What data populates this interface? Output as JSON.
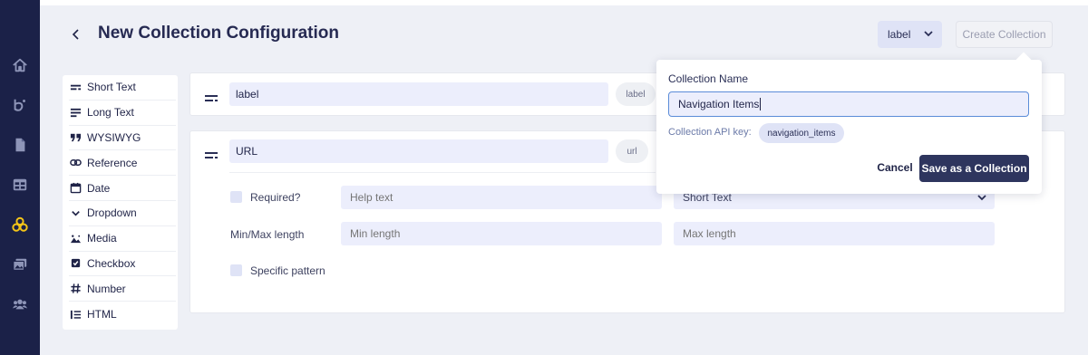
{
  "header": {
    "title": "New Collection Configuration",
    "back_icon": "chevron-left-icon",
    "label_select_value": "label",
    "create_button": "Create Collection"
  },
  "sidebar": {
    "items": [
      {
        "icon": "home-icon"
      },
      {
        "icon": "blog-icon"
      },
      {
        "icon": "document-icon"
      },
      {
        "icon": "table-icon"
      },
      {
        "icon": "collections-icon",
        "active": true
      },
      {
        "icon": "media-icon"
      },
      {
        "icon": "users-icon"
      }
    ],
    "active_color": "#f5c518"
  },
  "palette": {
    "items": [
      {
        "label": "Short Text",
        "icon": "short-text-icon"
      },
      {
        "label": "Long Text",
        "icon": "long-text-icon"
      },
      {
        "label": "WYSIWYG",
        "icon": "quote-icon"
      },
      {
        "label": "Reference",
        "icon": "link-icon"
      },
      {
        "label": "Date",
        "icon": "calendar-icon"
      },
      {
        "label": "Dropdown",
        "icon": "chevron-down-icon"
      },
      {
        "label": "Media",
        "icon": "image-icon"
      },
      {
        "label": "Checkbox",
        "icon": "checkbox-icon"
      },
      {
        "label": "Number",
        "icon": "hash-icon"
      },
      {
        "label": "HTML",
        "icon": "list-icon"
      }
    ]
  },
  "fields": [
    {
      "name_value": "label",
      "key_pill": "label"
    },
    {
      "name_value": "URL",
      "key_pill": "url",
      "required_label": "Required?",
      "help_placeholder": "Help text",
      "type_value": "Short Text",
      "minmax_label": "Min/Max length",
      "min_placeholder": "Min length",
      "max_placeholder": "Max length",
      "pattern_label": "Specific pattern"
    }
  ],
  "popover": {
    "title": "Collection Name",
    "name_value": "Navigation Items",
    "api_key_label": "Collection API key:",
    "api_key_value": "navigation_items",
    "cancel": "Cancel",
    "save": "Save as a Collection"
  },
  "colors": {
    "sidebar_bg": "#1b2148",
    "primary_button": "#2e355e",
    "input_bg": "#eceefc",
    "focus_border": "#5b8cd8"
  }
}
